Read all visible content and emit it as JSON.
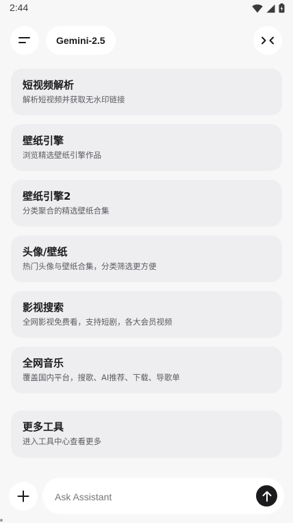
{
  "status_bar": {
    "time": "2:44",
    "icons": [
      "wifi-icon",
      "signal-icon",
      "battery-icon"
    ]
  },
  "header": {
    "menu_icon": "menu-icon",
    "model_name": "Gemini-2.5",
    "collapse_icon": "collapse-arrows-icon"
  },
  "tools": [
    {
      "title": "短视频解析",
      "subtitle": "解析短视频并获取无水印链接"
    },
    {
      "title": "壁纸引擎",
      "subtitle": "浏览精选壁纸引擎作品"
    },
    {
      "title": "壁纸引擎2",
      "subtitle": "分类聚合的精选壁纸合集"
    },
    {
      "title": "头像/壁纸",
      "subtitle": "热门头像与壁纸合集，分类筛选更方便"
    },
    {
      "title": "影视搜索",
      "subtitle": "全网影视免费看，支持短剧，各大会员视频"
    },
    {
      "title": "全网音乐",
      "subtitle": "覆盖国内平台，搜歌、AI推荐、下载、导歌单"
    },
    {
      "title": "更多工具",
      "subtitle": "进入工具中心查看更多"
    }
  ],
  "composer": {
    "add_icon": "plus-icon",
    "placeholder": "Ask Assistant",
    "value": "",
    "send_icon": "arrow-up-icon"
  },
  "colors": {
    "background": "#f7f7f8",
    "card": "#eeeef0",
    "surface": "#ffffff",
    "text": "#1b1b1d",
    "subtext": "#5b5b60",
    "send_button": "#1b1b1d"
  }
}
